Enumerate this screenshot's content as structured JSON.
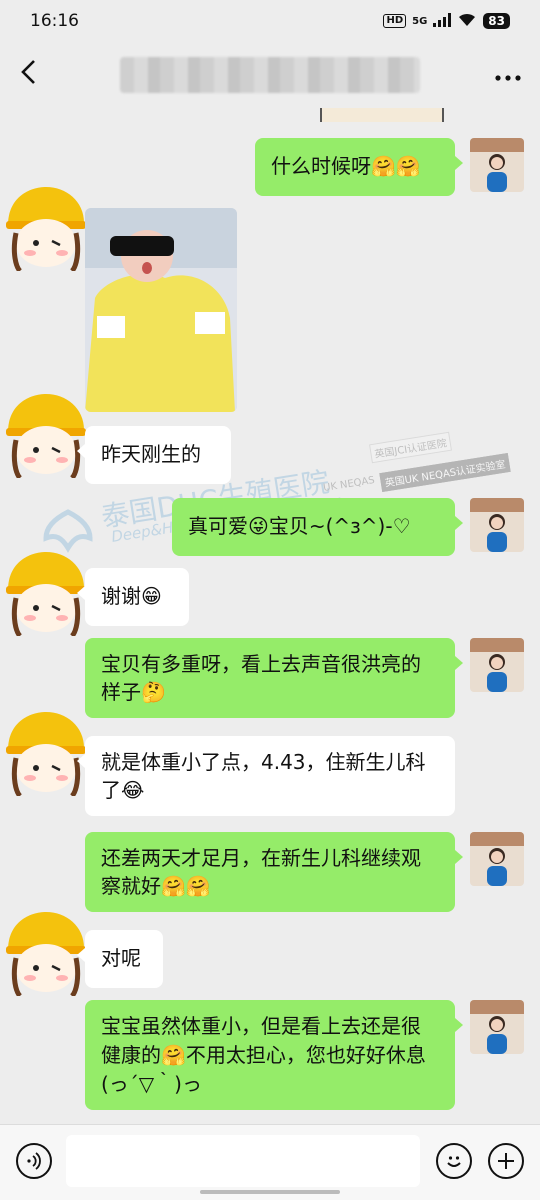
{
  "status_bar": {
    "time": "16:16",
    "hd": "HD",
    "net": "5G",
    "battery": "83"
  },
  "header": {
    "back_icon": "chevron-left-icon",
    "more_icon": "ellipsis-icon"
  },
  "watermark": {
    "main": "泰国DHC生殖医院",
    "sub": "Deep&Harmonicare IVF Center",
    "tag1": "英国JCI认证医院",
    "tag2": "英国UK NEQAS认证实验室",
    "tag3": "UK NEQAS"
  },
  "messages": [
    {
      "side": "right",
      "text": "什么时候呀🤗🤗"
    },
    {
      "side": "left",
      "type": "image",
      "image_desc": "baby-photo"
    },
    {
      "side": "left",
      "text": "昨天刚生的"
    },
    {
      "side": "right",
      "text": "真可爱😜宝贝~(^з^)-♡"
    },
    {
      "side": "left",
      "text": "谢谢😁"
    },
    {
      "side": "right",
      "text": "宝贝有多重呀，看上去声音很洪亮的样子🤔"
    },
    {
      "side": "left",
      "text": "就是体重小了点，4.43，住新生儿科了😂"
    },
    {
      "side": "right",
      "text": "还差两天才足月，在新生儿科继续观察就好🤗🤗"
    },
    {
      "side": "left",
      "text": "对呢"
    },
    {
      "side": "right",
      "text": "宝宝虽然体重小，但是看上去还是很健康的🤗不用太担心，您也好好休息(っ´▽｀)っ"
    }
  ],
  "input_bar": {
    "voice_icon": "voice-icon",
    "emoji_icon": "emoji-icon",
    "plus_icon": "plus-icon"
  },
  "colors": {
    "background": "#ededed",
    "sent_bubble": "#95ec69",
    "received_bubble": "#ffffff"
  }
}
